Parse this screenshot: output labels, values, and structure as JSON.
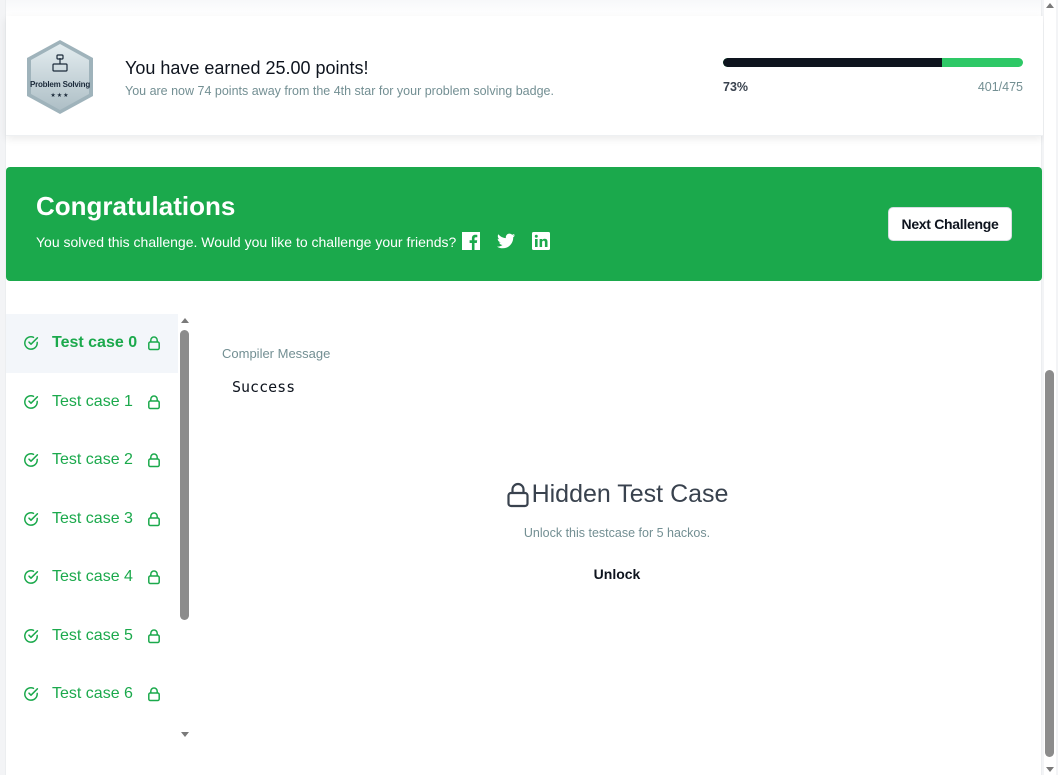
{
  "points": {
    "badge_label": "Problem Solving",
    "badge_stars": "★★★",
    "title": "You have earned 25.00 points!",
    "subtitle": "You are now 74 points away from the 4th star for your problem solving badge.",
    "progress_fraction": 0.73,
    "progress_percent": "73%",
    "progress_count": "401/475"
  },
  "congrats": {
    "title": "Congratulations",
    "subtitle": "You solved this challenge. Would you like to challenge your friends?",
    "next_button": "Next Challenge",
    "social_icons": [
      "facebook-icon",
      "twitter-icon",
      "linkedin-icon"
    ]
  },
  "test_cases": [
    {
      "label": "Test case 0",
      "active": true
    },
    {
      "label": "Test case 1",
      "active": false
    },
    {
      "label": "Test case 2",
      "active": false
    },
    {
      "label": "Test case 3",
      "active": false
    },
    {
      "label": "Test case 4",
      "active": false
    },
    {
      "label": "Test case 5",
      "active": false
    },
    {
      "label": "Test case 6",
      "active": false
    }
  ],
  "compiler": {
    "label": "Compiler Message",
    "message": "Success"
  },
  "hidden": {
    "title": "Hidden Test Case",
    "subtitle": "Unlock this testcase for 5 hackos.",
    "unlock_button": "Unlock"
  },
  "colors": {
    "green": "#1ba94c",
    "progress_dark": "#0e141e",
    "progress_green": "#2ec866"
  }
}
